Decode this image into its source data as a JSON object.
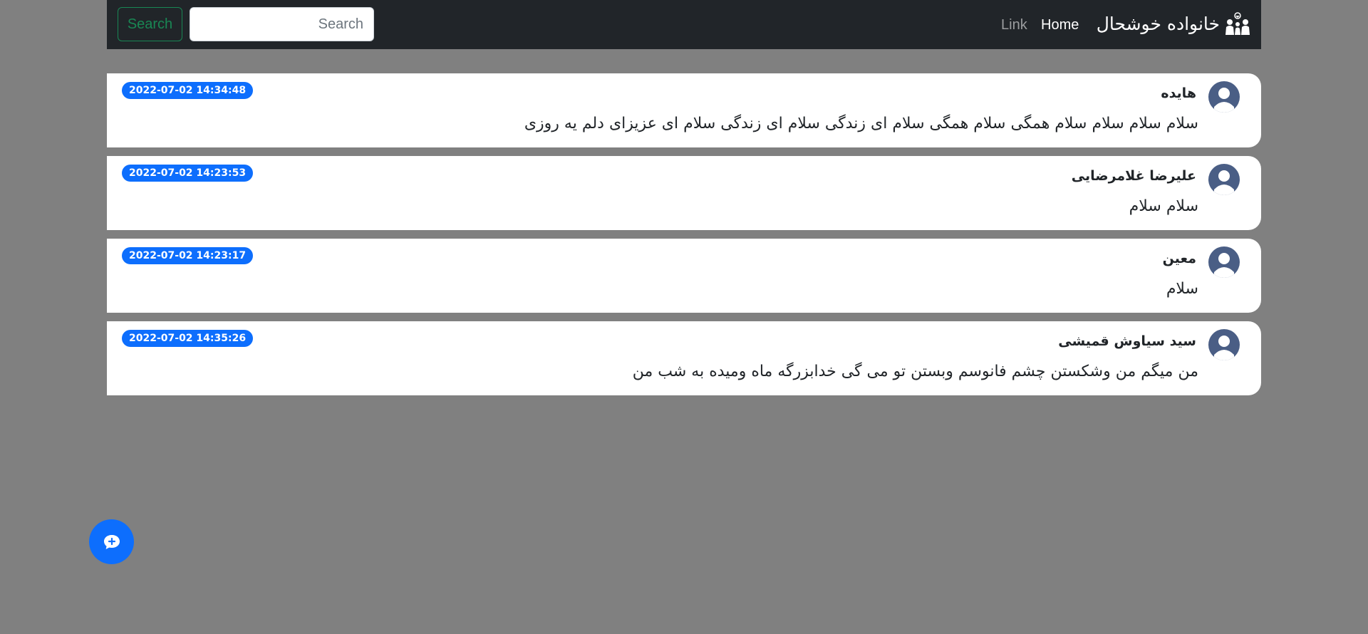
{
  "navbar": {
    "brand": "خانواده خوشحال",
    "brand_icon": "family-icon",
    "links": {
      "home": "Home",
      "link": "Link"
    },
    "search": {
      "placeholder": "Search",
      "value": "",
      "button_label": "Search"
    },
    "background_color": "#212529"
  },
  "messages": [
    {
      "author": "هایده",
      "text": "سلام سلام سلام سلام همگی سلام همگی سلام ای زندگی سلام ای زندگی سلام ای عزیزای دلم یه روزی",
      "timestamp": "2022-07-02 14:34:48"
    },
    {
      "author": "علیرضا غلامرضایی",
      "text": "سلام سلام",
      "timestamp": "2022-07-02 14:23:53"
    },
    {
      "author": "معین",
      "text": "سلام",
      "timestamp": "2022-07-02 14:23:17"
    },
    {
      "author": "سید سیاوش قمیشی",
      "text": "من میگم من وشکستن چشم فانوسم وبستن تو می گی خدابزرگه ماه ومیده به شب من",
      "timestamp": "2022-07-02 14:35:26"
    }
  ],
  "avatar_icon": "user-avatar-icon",
  "new_message_button": {
    "icon": "chat-plus-icon"
  },
  "colors": {
    "page_background": "#808080",
    "badge": "#0d6efd",
    "search_button": "#198754",
    "avatar": "#4a5e85"
  }
}
